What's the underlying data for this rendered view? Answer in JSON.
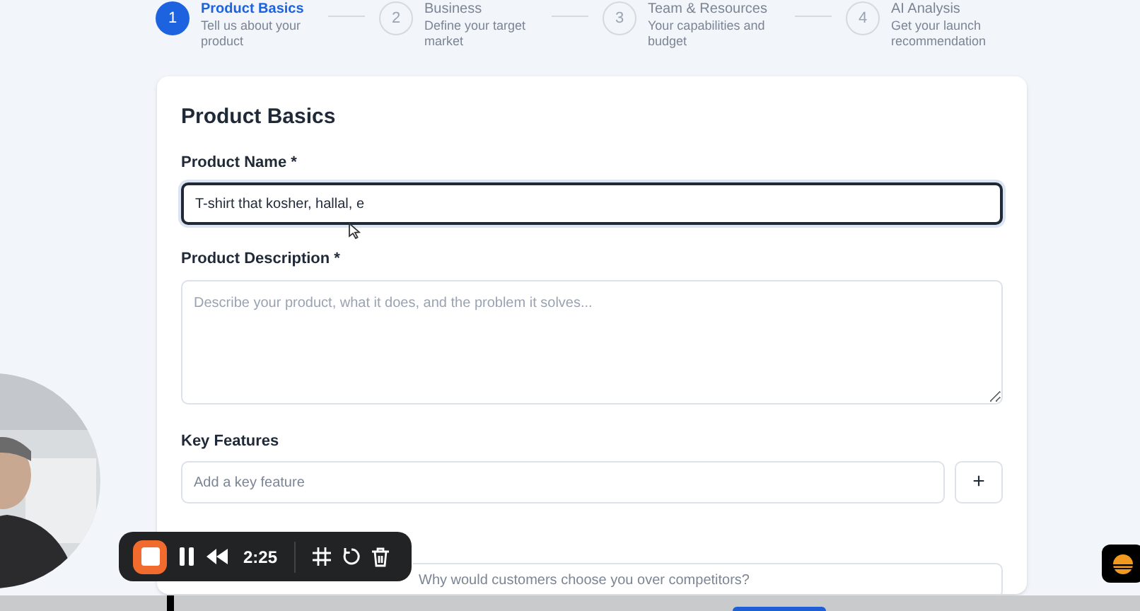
{
  "steps": [
    {
      "number": "1",
      "title": "Product Basics",
      "subtitle": "Tell us about your product",
      "selected": true
    },
    {
      "number": "2",
      "title": "Business",
      "subtitle": "Define your target market",
      "selected": false
    },
    {
      "number": "3",
      "title": "Team & Resources",
      "subtitle": "Your capabilities and budget",
      "selected": false
    },
    {
      "number": "4",
      "title": "AI Analysis",
      "subtitle": "Get your launch recommendation",
      "selected": false
    }
  ],
  "form": {
    "title": "Product Basics",
    "fields": [
      {
        "kind": "input",
        "label": "Product Name *",
        "value": "T-shirt that kosher, hallal, e",
        "focused": true
      },
      {
        "kind": "textarea",
        "label": "Product Description *",
        "placeholder": "Describe your product, what it does, and the problem it solves...",
        "focused": false
      },
      {
        "kind": "feature",
        "label": "Key Features",
        "placeholder": "Add a key feature",
        "button": "+",
        "focused": false
      },
      {
        "kind": "input",
        "placeholder": "Why would customers choose you over competitors?",
        "focused": false
      }
    ]
  },
  "recorder": {
    "time": "2:25"
  }
}
